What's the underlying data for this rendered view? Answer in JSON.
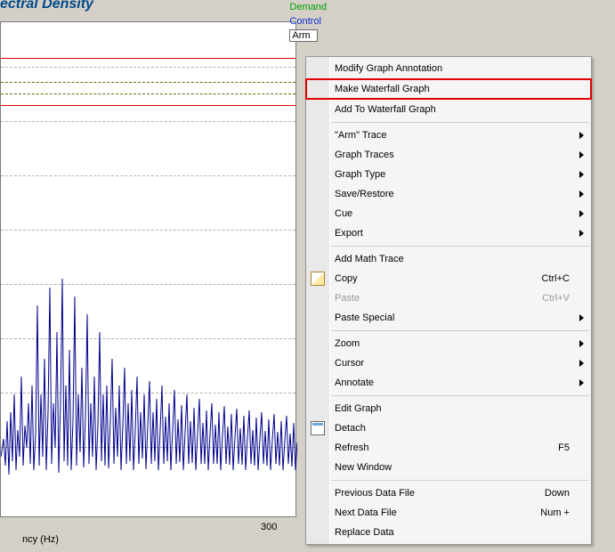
{
  "title_fragment": "ectral Density",
  "legend": {
    "demand": "Demand",
    "control": "Control",
    "arm": "Arm"
  },
  "x_axis": {
    "tick_300": "300",
    "label": "ncy (Hz)"
  },
  "menu": {
    "modify": "Modify Graph Annotation",
    "make_wf": "Make Waterfall Graph",
    "add_wf": "Add To Waterfall Graph",
    "arm_trace": "\"Arm\" Trace",
    "graph_traces": "Graph Traces",
    "graph_type": "Graph Type",
    "save_restore": "Save/Restore",
    "cue": "Cue",
    "export": "Export",
    "add_math": "Add Math Trace",
    "copy": "Copy",
    "copy_sc": "Ctrl+C",
    "paste": "Paste",
    "paste_sc": "Ctrl+V",
    "paste_special": "Paste Special",
    "zoom": "Zoom",
    "cursor": "Cursor",
    "annotate": "Annotate",
    "edit_graph": "Edit Graph",
    "detach": "Detach",
    "refresh": "Refresh",
    "refresh_sc": "F5",
    "new_window": "New Window",
    "prev_file": "Previous Data File",
    "prev_file_sc": "Down",
    "next_file": "Next Data File",
    "next_file_sc": "Num +",
    "replace": "Replace Data"
  },
  "chart_data": {
    "type": "line",
    "title": "Spectral Density",
    "xlabel": "Frequency (Hz)",
    "ylabel": "",
    "xlim": [
      0,
      350
    ],
    "x_ticks": [
      300
    ],
    "series": [
      {
        "name": "Demand",
        "color": "#00a000"
      },
      {
        "name": "Control",
        "color": "#1030d0"
      },
      {
        "name": "Arm",
        "color": "#00008b",
        "note": "noisy spectral trace occupying lower half of plot"
      }
    ],
    "reference_lines": [
      {
        "color": "#e00000",
        "y_rel": 0.07
      },
      {
        "color": "#4a7a00",
        "y_rel": 0.12,
        "style": "dashed"
      },
      {
        "color": "#4a7a00",
        "y_rel": 0.145,
        "style": "dashed"
      },
      {
        "color": "#e00000",
        "y_rel": 0.165
      }
    ]
  }
}
